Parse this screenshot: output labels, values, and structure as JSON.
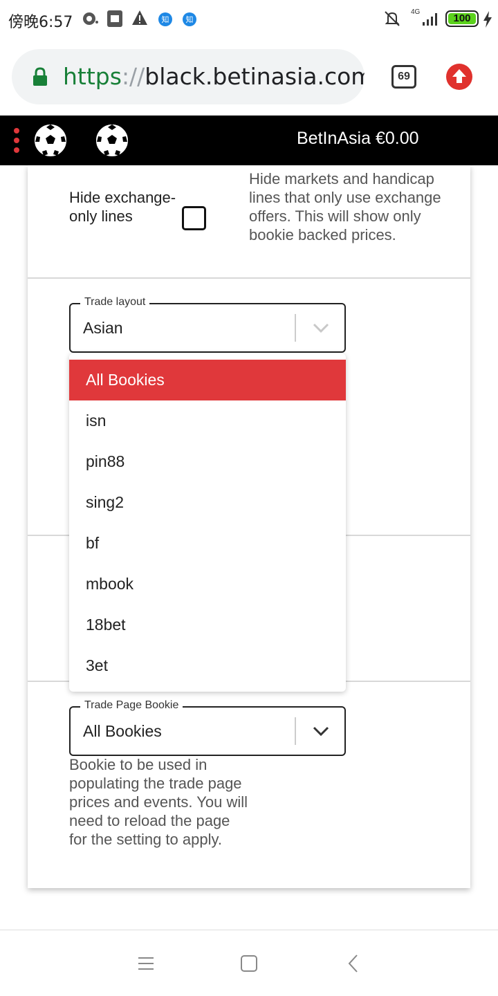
{
  "status_bar": {
    "time": "傍晚6:57",
    "network": "4G",
    "battery": "100"
  },
  "browser": {
    "url_scheme": "https",
    "url_separator": "://",
    "url_host": "black.betinasia.com/",
    "tabs_count": "69"
  },
  "app_header": {
    "account": "BetInAsia €0.00"
  },
  "settings": {
    "hide_exchange": {
      "label": "Hide exchange-only lines",
      "description": "Hide markets and handicap lines that only use exchange offers. This will show only bookie backed prices.",
      "checked": false
    },
    "trade_layout": {
      "legend": "Trade layout",
      "value": "Asian"
    },
    "dropdown": {
      "items": [
        "All Bookies",
        "isn",
        "pin88",
        "sing2",
        "bf",
        "mbook",
        "18bet",
        "3et"
      ],
      "selected_index": 0
    },
    "trade_page_bookie": {
      "legend": "Trade Page Bookie",
      "value": "All Bookies",
      "description": "Bookie to be used in populating the trade page prices and events. You will need to reload the page for the setting to apply."
    }
  },
  "colors": {
    "accent_red": "#e0383b",
    "header_black": "#000000",
    "url_green": "#188038",
    "battery_green": "#5bd21c"
  },
  "icons": {
    "logo": "soccer-ball-icon",
    "menu": "vertical-dots-icon",
    "secure": "lock-icon",
    "upload": "upload-arrow-icon",
    "nav": [
      "menu-lines-icon",
      "square-home-icon",
      "back-chevron-icon"
    ]
  }
}
